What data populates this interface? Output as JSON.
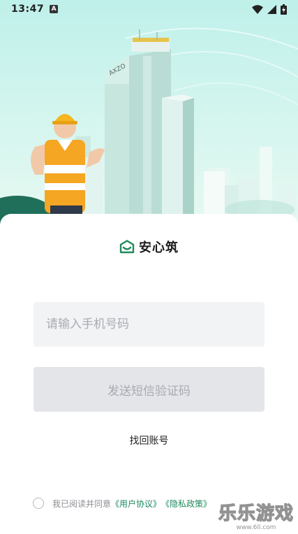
{
  "status_bar": {
    "time": "13:47",
    "notification_badge": "A"
  },
  "hero": {
    "building_label": "AXZO"
  },
  "logo": {
    "text": "安心筑"
  },
  "login": {
    "phone_placeholder": "请输入手机号码",
    "send_code_label": "发送短信验证码",
    "recover_label": "找回账号"
  },
  "agreement": {
    "prefix": "我已阅读并同意",
    "user_agreement": "《用户协议》",
    "privacy_policy": "《隐私政策》"
  },
  "watermark": {
    "brand": "乐乐游戏",
    "url": "www.6ll.com"
  },
  "colors": {
    "accent": "#1e8a5f",
    "hero_bg": "#c7f2ea",
    "field_bg": "#f2f3f5",
    "button_disabled": "#e4e5e9"
  }
}
